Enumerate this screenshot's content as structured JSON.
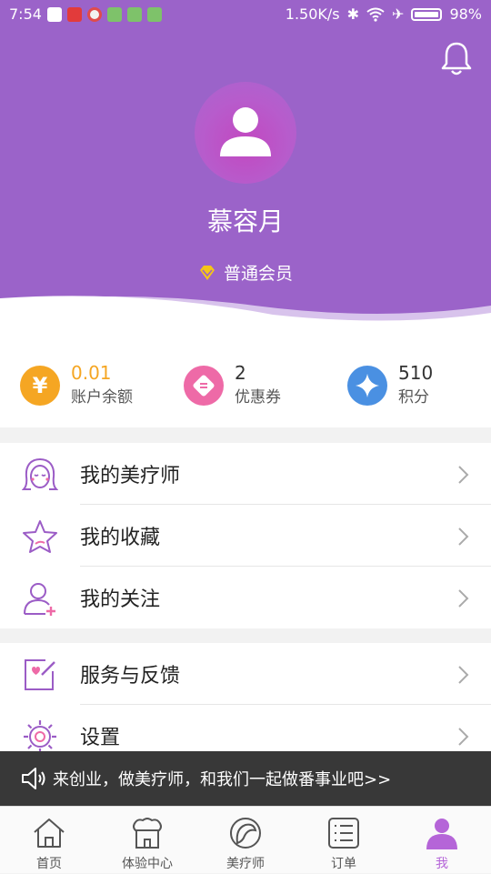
{
  "status_bar": {
    "time": "7:54",
    "network_speed": "1.50K/s",
    "battery": "98%"
  },
  "profile": {
    "name": "慕容月",
    "member_level": "普通会员"
  },
  "stats": [
    {
      "value": "0.01",
      "label": "账户余额",
      "icon": "yen-icon",
      "color": "#f5a623"
    },
    {
      "value": "2",
      "label": "优惠券",
      "icon": "coupon-icon",
      "color": "#ee6aa7"
    },
    {
      "value": "510",
      "label": "积分",
      "icon": "star-icon",
      "color": "#4a90e2"
    }
  ],
  "menu_group_1": [
    {
      "label": "我的美疗师",
      "icon": "woman-face-icon"
    },
    {
      "label": "我的收藏",
      "icon": "star-outline-icon"
    },
    {
      "label": "我的关注",
      "icon": "user-add-icon"
    }
  ],
  "menu_group_2": [
    {
      "label": "服务与反馈",
      "icon": "feedback-icon"
    },
    {
      "label": "设置",
      "icon": "settings-icon"
    }
  ],
  "banner": {
    "text": "来创业，做美疗师，和我们一起做番事业吧>>"
  },
  "tabs": [
    {
      "label": "首页",
      "icon": "home-icon"
    },
    {
      "label": "体验中心",
      "icon": "shop-icon"
    },
    {
      "label": "美疗师",
      "icon": "therapist-icon"
    },
    {
      "label": "订单",
      "icon": "order-list-icon"
    },
    {
      "label": "我",
      "icon": "profile-icon",
      "active": true
    }
  ],
  "colors": {
    "header": "#9b63c9",
    "accent": "#b565d8",
    "balance_value": "#f5a623"
  }
}
